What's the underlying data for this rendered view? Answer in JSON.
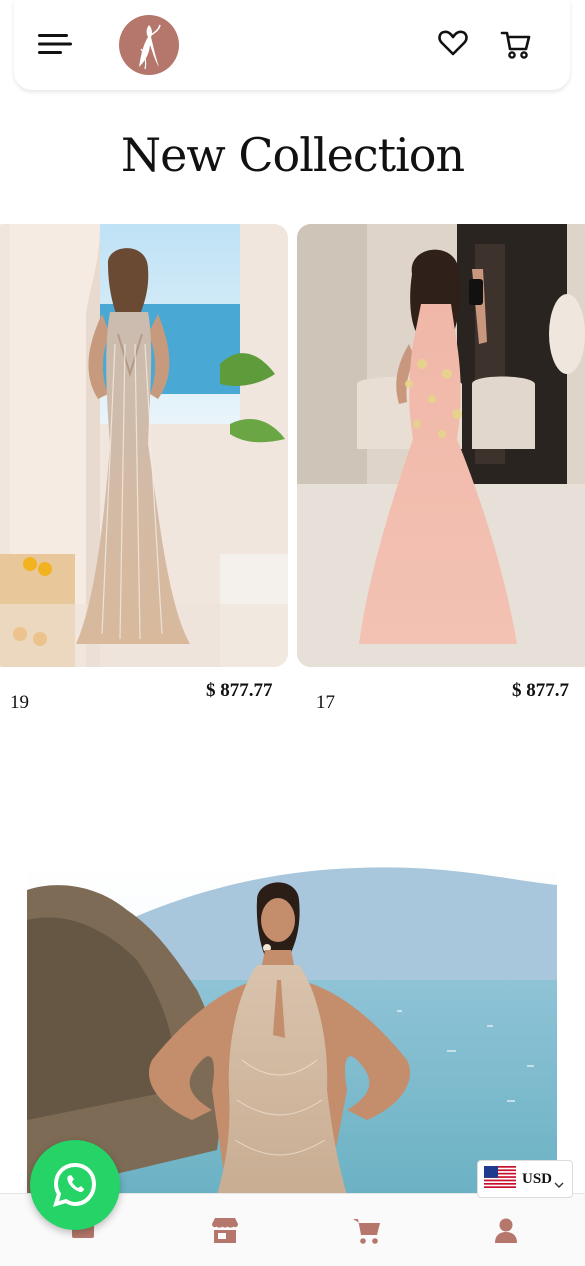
{
  "header": {
    "menu_icon": "hamburger-icon",
    "logo_icon": "dress-silhouette-logo",
    "wishlist_icon": "heart-icon",
    "cart_icon": "cart-icon",
    "logo_color": "#b5776b"
  },
  "section": {
    "title": "New Collection"
  },
  "products": [
    {
      "sku": "19",
      "price": "$ 877.77",
      "image": "sequin-mermaid-gown"
    },
    {
      "sku": "17",
      "price": "$ 877.7",
      "image": "pink-floral-tulle-gown"
    }
  ],
  "banner": {
    "image": "halter-beaded-gown-seaside"
  },
  "whatsapp": {
    "icon": "whatsapp-icon",
    "color": "#25d366"
  },
  "currency": {
    "code": "USD",
    "flag": "us-flag-icon"
  },
  "bottom_nav": {
    "items": [
      {
        "icon": "home-icon"
      },
      {
        "icon": "store-icon"
      },
      {
        "icon": "cart-icon"
      },
      {
        "icon": "user-icon"
      }
    ],
    "accent": "#b5776b"
  }
}
